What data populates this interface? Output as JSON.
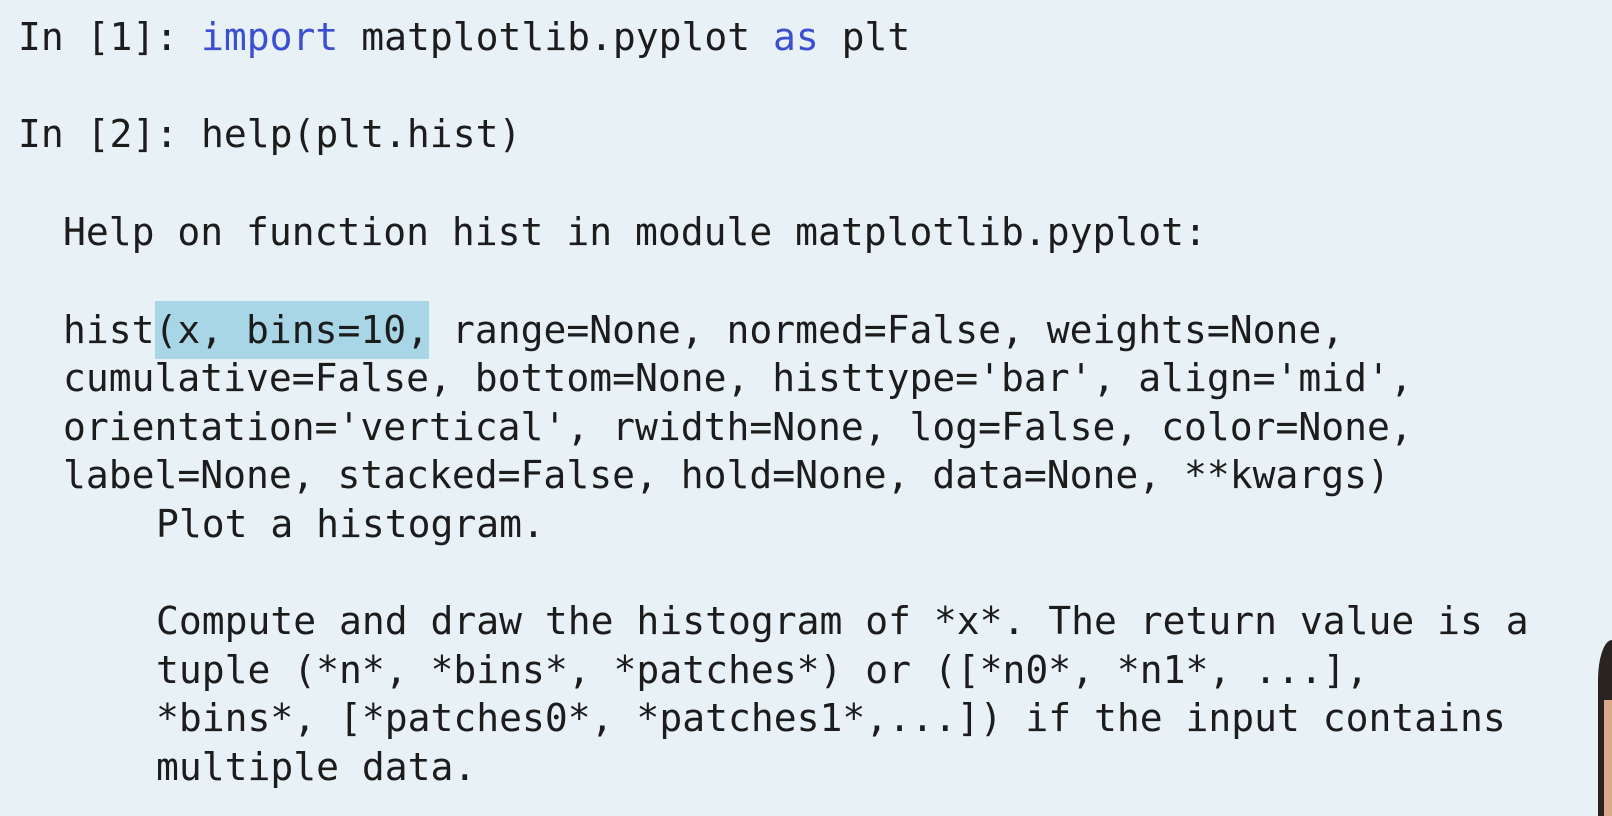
{
  "cells": [
    {
      "prompt": "In [1]: ",
      "tokens": [
        "import",
        " matplotlib.pyplot ",
        "as",
        " plt"
      ]
    },
    {
      "prompt": "In [2]: ",
      "code": "help(plt.hist)"
    }
  ],
  "help": {
    "header": "Help on function hist in module matplotlib.pyplot:",
    "signature": {
      "prefix": "hist",
      "highlighted": "(x, bins=10,",
      "rest_line1": " range=None, normed=False, weights=None,",
      "line2": "cumulative=False, bottom=None, histtype='bar', align='mid',",
      "line3": "orientation='vertical', rwidth=None, log=False, color=None,",
      "line4": "label=None, stacked=False, hold=None, data=None, **kwargs)"
    },
    "summary": "Plot a histogram.",
    "body": [
      "Compute and draw the histogram of *x*. The return value is a",
      "tuple (*n*, *bins*, *patches*) or ([*n0*, *n1*, ...],",
      "*bins*, [*patches0*, *patches1*,...]) if the input contains",
      "multiple data."
    ]
  },
  "colors": {
    "background": "#e7f1f6",
    "keyword": "#3b4fd0",
    "text": "#1c1c1c",
    "highlight": "#a8d6e6"
  }
}
